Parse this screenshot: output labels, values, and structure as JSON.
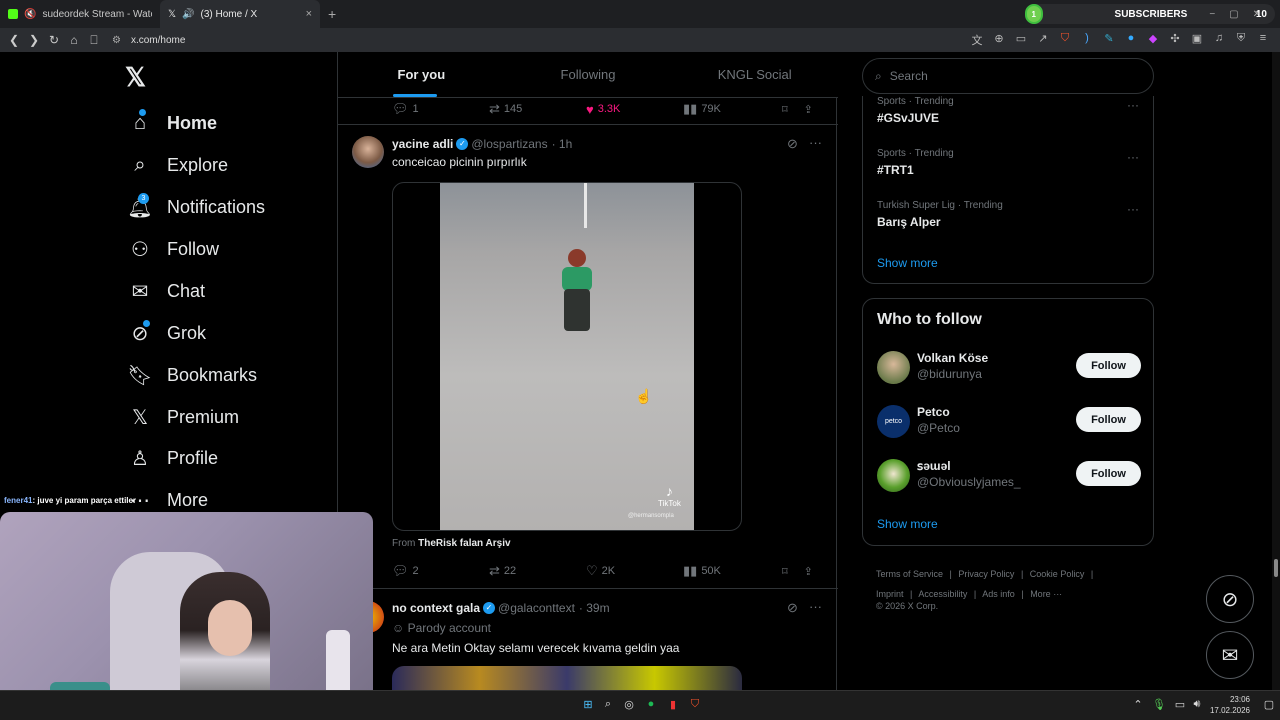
{
  "browser": {
    "tabs": [
      {
        "label": "sudeordek Stream - Watch Live o",
        "favicon_color": "#53fc18"
      },
      {
        "label": "(3) Home / X",
        "favicon_color": "#ffffff",
        "close": "×"
      }
    ],
    "new_tab": "+",
    "url": "x.com/home",
    "subscribers": {
      "initial": "1",
      "label": "SUBSCRIBERS",
      "count": "10"
    }
  },
  "nav": {
    "logo": "𝕏",
    "items": [
      {
        "label": "Home",
        "icon": "home-icon",
        "glyph": "⌂"
      },
      {
        "label": "Explore",
        "icon": "search-icon",
        "glyph": "⌕"
      },
      {
        "label": "Notifications",
        "icon": "bell-icon",
        "glyph": "♫",
        "badge": "3"
      },
      {
        "label": "Follow",
        "icon": "follow-icon",
        "glyph": "⚇"
      },
      {
        "label": "Chat",
        "icon": "mail-icon",
        "glyph": "✉"
      },
      {
        "label": "Grok",
        "icon": "grok-icon",
        "glyph": "⊘"
      },
      {
        "label": "Bookmarks",
        "icon": "bookmark-icon",
        "glyph": "⌑"
      },
      {
        "label": "Premium",
        "icon": "x-icon",
        "glyph": "𝕏"
      },
      {
        "label": "Profile",
        "icon": "profile-icon",
        "glyph": "♙"
      },
      {
        "label": "More",
        "icon": "more-icon",
        "glyph": "⋯"
      }
    ]
  },
  "feed": {
    "tabs": [
      "For you",
      "Following",
      "KNGL Social"
    ],
    "prev_actions": {
      "replies": "1",
      "reposts": "145",
      "likes": "3.3K",
      "views": "79K"
    },
    "post1": {
      "name": "yacine adli",
      "handle": "@lospartizans",
      "time": "· 1h",
      "text": "conceicao picinin pırpırlık",
      "watermark": "TikTok",
      "watermark_user": "@hermansompla",
      "from_label": "From",
      "from_source": "TheRisk falan Arşiv",
      "actions": {
        "replies": "2",
        "reposts": "22",
        "likes": "2K",
        "views": "50K"
      }
    },
    "post2": {
      "name": "no context gala",
      "handle": "@galaconttext",
      "time": "· 39m",
      "tag": "Parody account",
      "text": "Ne ara Metin Oktay selamı verecek kıvama geldin yaa"
    }
  },
  "sidebar": {
    "search_placeholder": "Search",
    "trends": [
      {
        "meta": "Sports · Trending",
        "title": "#GSvJUVE"
      },
      {
        "meta": "Sports · Trending",
        "title": "#TRT1"
      },
      {
        "meta": "Turkish Super Lig · Trending",
        "title": "Barış Alper"
      }
    ],
    "trends_show_more": "Show more",
    "who_to_follow": {
      "title": "Who to follow",
      "accounts": [
        {
          "name": "Volkan Köse",
          "handle": "@bidurunya",
          "button": "Follow",
          "avatar_color": "#6a7a4a"
        },
        {
          "name": "Petco",
          "handle": "@Petco",
          "button": "Follow",
          "avatar_color": "#0a2f6b",
          "avatar_text": "petco"
        },
        {
          "name": "ꜱəɯǝl",
          "handle": "@Obviouslyjames_",
          "button": "Follow",
          "avatar_color": "#5aa02c"
        }
      ],
      "show_more": "Show more"
    },
    "footer": {
      "links": [
        "Terms of Service",
        "Privacy Policy",
        "Cookie Policy",
        "Imprint",
        "Accessibility",
        "Ads info",
        "More ···"
      ],
      "copyright": "© 2026 X Corp."
    }
  },
  "overlay": {
    "chat_user": "fener41",
    "chat_text": ": juve yi param parça ettiler"
  },
  "taskbar": {
    "time": "23:06",
    "date": "17.02.2026"
  }
}
